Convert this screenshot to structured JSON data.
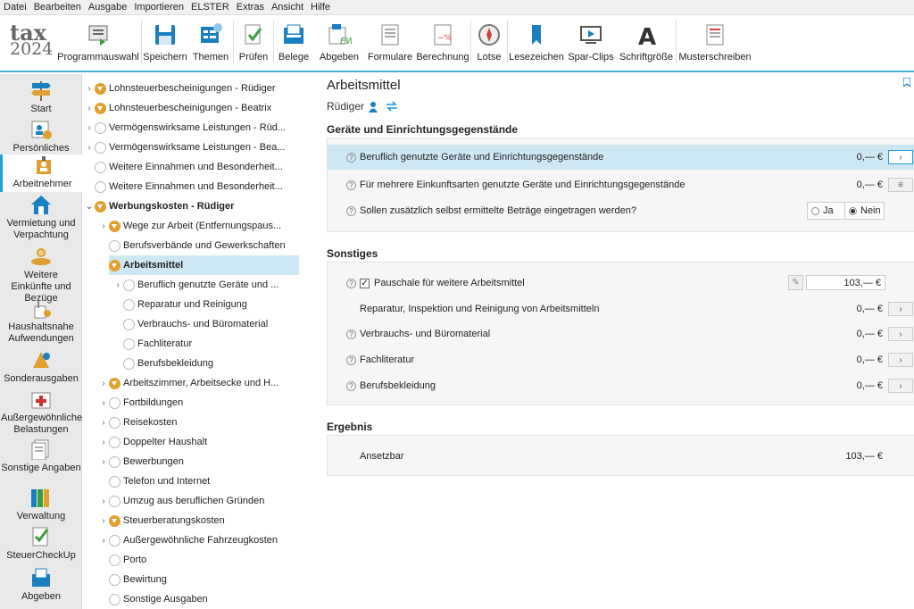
{
  "menu": [
    "Datei",
    "Bearbeiten",
    "Ausgabe",
    "Importieren",
    "ELSTER",
    "Extras",
    "Ansicht",
    "Hilfe"
  ],
  "logo": {
    "line1": "tax",
    "line2": "2024"
  },
  "toolbar": [
    "Programmauswahl",
    "Speichern",
    "Themen",
    "Prüfen",
    "Belege",
    "Abgeben",
    "Formulare",
    "Berechnung",
    "Lotse",
    "Lesezeichen",
    "Spar-Clips",
    "Schriftgröße",
    "Musterschreiben"
  ],
  "sidebar": [
    "Start",
    "Persönliches",
    "Arbeitnehmer",
    "Vermietung und Verpachtung",
    "Weitere Einkünfte und Bezüge",
    "Haushaltsnahe Aufwendungen",
    "Sonderausgaben",
    "Außergewöhnliche Belastungen",
    "Sonstige Angaben",
    "Verwaltung",
    "SteuerCheckUp",
    "Abgeben"
  ],
  "tree": [
    {
      "label": "Lohnsteuerbescheinigungen - Rüdiger"
    },
    {
      "label": "Lohnsteuerbescheinigungen - Beatrix"
    },
    {
      "label": "Vermögenswirksame Leistungen - Rüd..."
    },
    {
      "label": "Vermögenswirksame Leistungen - Bea..."
    },
    {
      "label": "Weitere Einnahmen und Besonderheit..."
    },
    {
      "label": "Weitere Einnahmen und Besonderheit..."
    },
    {
      "label": "Werbungskosten - Rüdiger"
    },
    {
      "label": "Wege zur Arbeit (Entfernungspaus..."
    },
    {
      "label": "Berufsverbände und Gewerkschaften"
    },
    {
      "label": "Arbeitsmittel"
    },
    {
      "label": "Beruflich genutzte Geräte und ..."
    },
    {
      "label": "Reparatur und Reinigung"
    },
    {
      "label": "Verbrauchs- und Büromaterial"
    },
    {
      "label": "Fachliteratur"
    },
    {
      "label": "Berufsbekleidung"
    },
    {
      "label": "Arbeitszimmer, Arbeitsecke und H..."
    },
    {
      "label": "Fortbildungen"
    },
    {
      "label": "Reisekosten"
    },
    {
      "label": "Doppelter Haushalt"
    },
    {
      "label": "Bewerbungen"
    },
    {
      "label": "Telefon und Internet"
    },
    {
      "label": "Umzug aus beruflichen Gründen"
    },
    {
      "label": "Steuerberatungskosten"
    },
    {
      "label": "Außergewöhnliche Fahrzeugkosten"
    },
    {
      "label": "Porto"
    },
    {
      "label": "Bewirtung"
    },
    {
      "label": "Sonstige Ausgaben"
    }
  ],
  "main": {
    "title": "Arbeitsmittel",
    "person": "Rüdiger",
    "section1": {
      "title": "Geräte und Einrichtungsgegenstände",
      "rows": [
        {
          "label": "Beruflich genutzte Geräte und Einrichtungsgegenstände",
          "value": "0,— €"
        },
        {
          "label": "Für mehrere Einkunftsarten genutzte Geräte und Einrichtungsgegenstände",
          "value": "0,— €"
        },
        {
          "label": "Sollen zusätzlich selbst ermittelte Beträge eingetragen werden?"
        }
      ],
      "radio": {
        "yes": "Ja",
        "no": "Nein",
        "selected": "Nein"
      }
    },
    "section2": {
      "title": "Sonstiges",
      "pauschale": {
        "label": "Pauschale für weitere Arbeitsmittel",
        "value": "103,— €",
        "checked": true
      },
      "rows": [
        {
          "label": "Reparatur, Inspektion und Reinigung von Arbeitsmitteln",
          "value": "0,— €"
        },
        {
          "label": "Verbrauchs- und Büromaterial",
          "value": "0,— €"
        },
        {
          "label": "Fachliteratur",
          "value": "0,— €"
        },
        {
          "label": "Berufsbekleidung",
          "value": "0,— €"
        }
      ]
    },
    "section3": {
      "title": "Ergebnis",
      "label": "Ansetzbar",
      "value": "103,— €"
    }
  },
  "colors": {
    "accent": "#1a9ed9",
    "selected": "#cde8f3",
    "orange": "#e0a030"
  }
}
